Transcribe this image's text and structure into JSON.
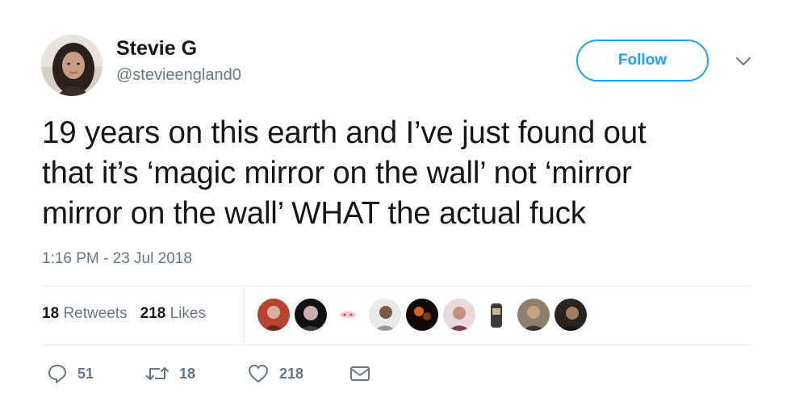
{
  "user": {
    "display_name": "Stevie G",
    "handle": "@stevieengland0"
  },
  "follow_label": "Follow",
  "tweet": {
    "lines": [
      "19 years on this earth and I’ve just found out",
      "that it’s ‘magic mirror on the wall’ not ‘mirror",
      "mirror on the wall’ WHAT the actual fuck"
    ],
    "timestamp": "1:16 PM - 23 Jul 2018"
  },
  "stats": {
    "retweets_count": "18",
    "retweets_label": "Retweets",
    "likes_count": "218",
    "likes_label": "Likes"
  },
  "actions": {
    "reply_count": "51",
    "retweet_count": "18",
    "like_count": "218"
  },
  "colors": {
    "accent": "#1da1f2",
    "secondary_text": "#657786",
    "primary_text": "#14171a",
    "divider": "#e6ecf0"
  },
  "icons": [
    "reply-icon",
    "retweet-icon",
    "heart-icon",
    "envelope-icon",
    "chevron-down-icon"
  ]
}
